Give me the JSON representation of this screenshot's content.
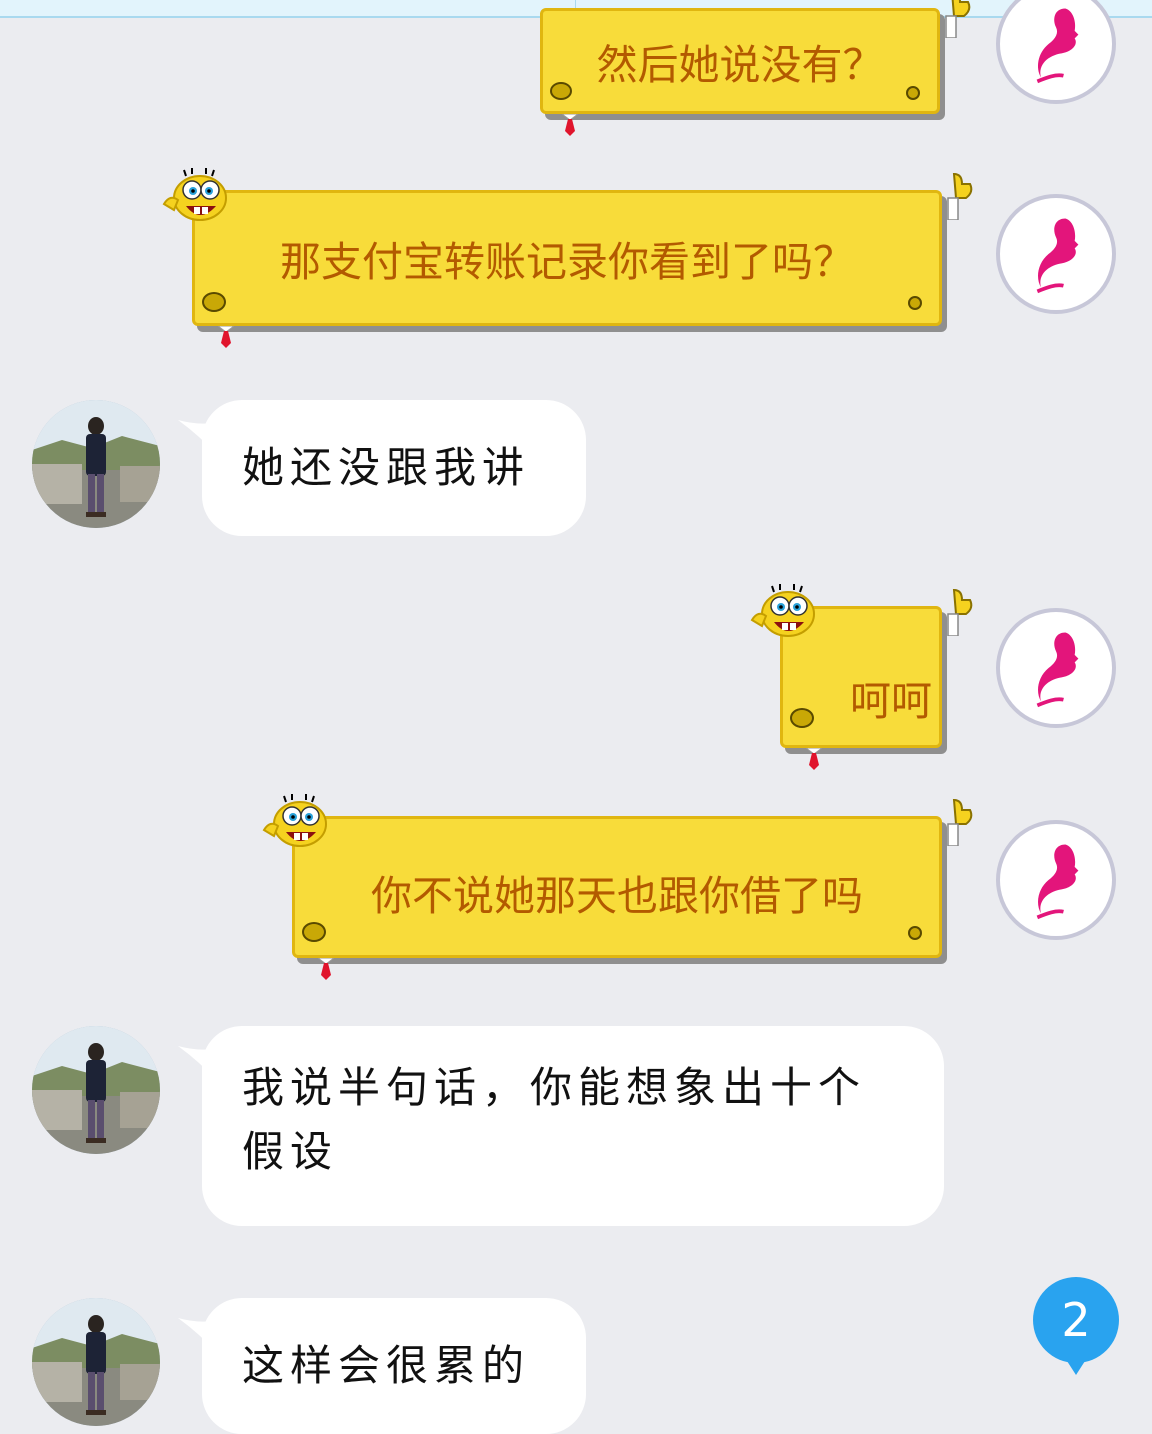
{
  "colors": {
    "background": "#ebecf0",
    "sponge_fill": "#f8dc3a",
    "sponge_text": "#b35a00",
    "avatar_f_accent": "#e3157b",
    "badge": "#29a3ef"
  },
  "messages": [
    {
      "id": "m1",
      "side": "right",
      "style": "sponge",
      "text": "然后她说没有？"
    },
    {
      "id": "m2",
      "side": "right",
      "style": "sponge",
      "text": "那支付宝转账记录你看到了吗？"
    },
    {
      "id": "m3",
      "side": "left",
      "style": "white",
      "text": "她还没跟我讲"
    },
    {
      "id": "m4",
      "side": "right",
      "style": "sponge",
      "text": "呵呵"
    },
    {
      "id": "m5",
      "side": "right",
      "style": "sponge",
      "text": "你不说她那天也跟你借了吗"
    },
    {
      "id": "m6",
      "side": "left",
      "style": "white",
      "text": "我说半句话，你能想象出十个假设"
    },
    {
      "id": "m7",
      "side": "left",
      "style": "white",
      "text": "这样会很累的"
    }
  ],
  "unread_badge": "2",
  "icons": {
    "self_avatar": "female-profile-avatar",
    "other_avatar": "photo-avatar",
    "badge": "unread-count-badge"
  }
}
